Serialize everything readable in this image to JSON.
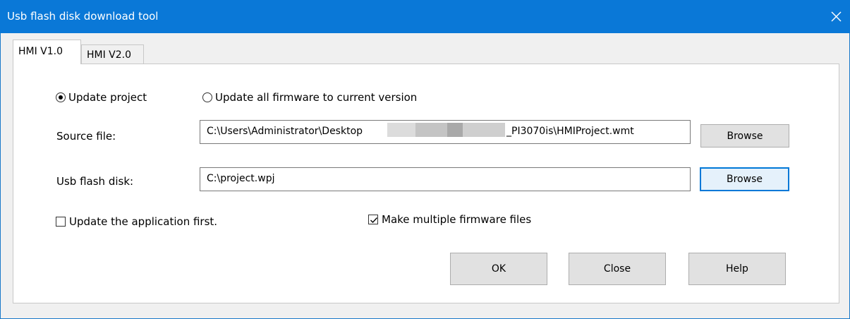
{
  "window": {
    "title": "Usb flash disk download tool"
  },
  "tabs": [
    {
      "label": "HMI V1.0",
      "active": true
    },
    {
      "label": "HMI V2.0",
      "active": false
    }
  ],
  "update_mode": {
    "options": [
      {
        "label": "Update project",
        "checked": true
      },
      {
        "label": "Update all firmware to current version",
        "checked": false
      }
    ]
  },
  "source_file": {
    "label": "Source file:",
    "value_prefix": "C:\\Users\\Administrator\\Desktop",
    "value_suffix": "_PI3070is\\HMIProject.wmt",
    "browse_label": "Browse"
  },
  "usb_disk": {
    "label": "Usb flash disk:",
    "value": "C:\\project.wpj",
    "browse_label": "Browse"
  },
  "options": {
    "update_app_first": {
      "label": "Update the application first.",
      "checked": false
    },
    "multiple_firmware": {
      "label": "Make multiple firmware files",
      "checked": true
    }
  },
  "buttons": {
    "ok": "OK",
    "close": "Close",
    "help": "Help"
  },
  "colors": {
    "titlebar": "#0a78d7",
    "focus_border": "#0078d7"
  }
}
